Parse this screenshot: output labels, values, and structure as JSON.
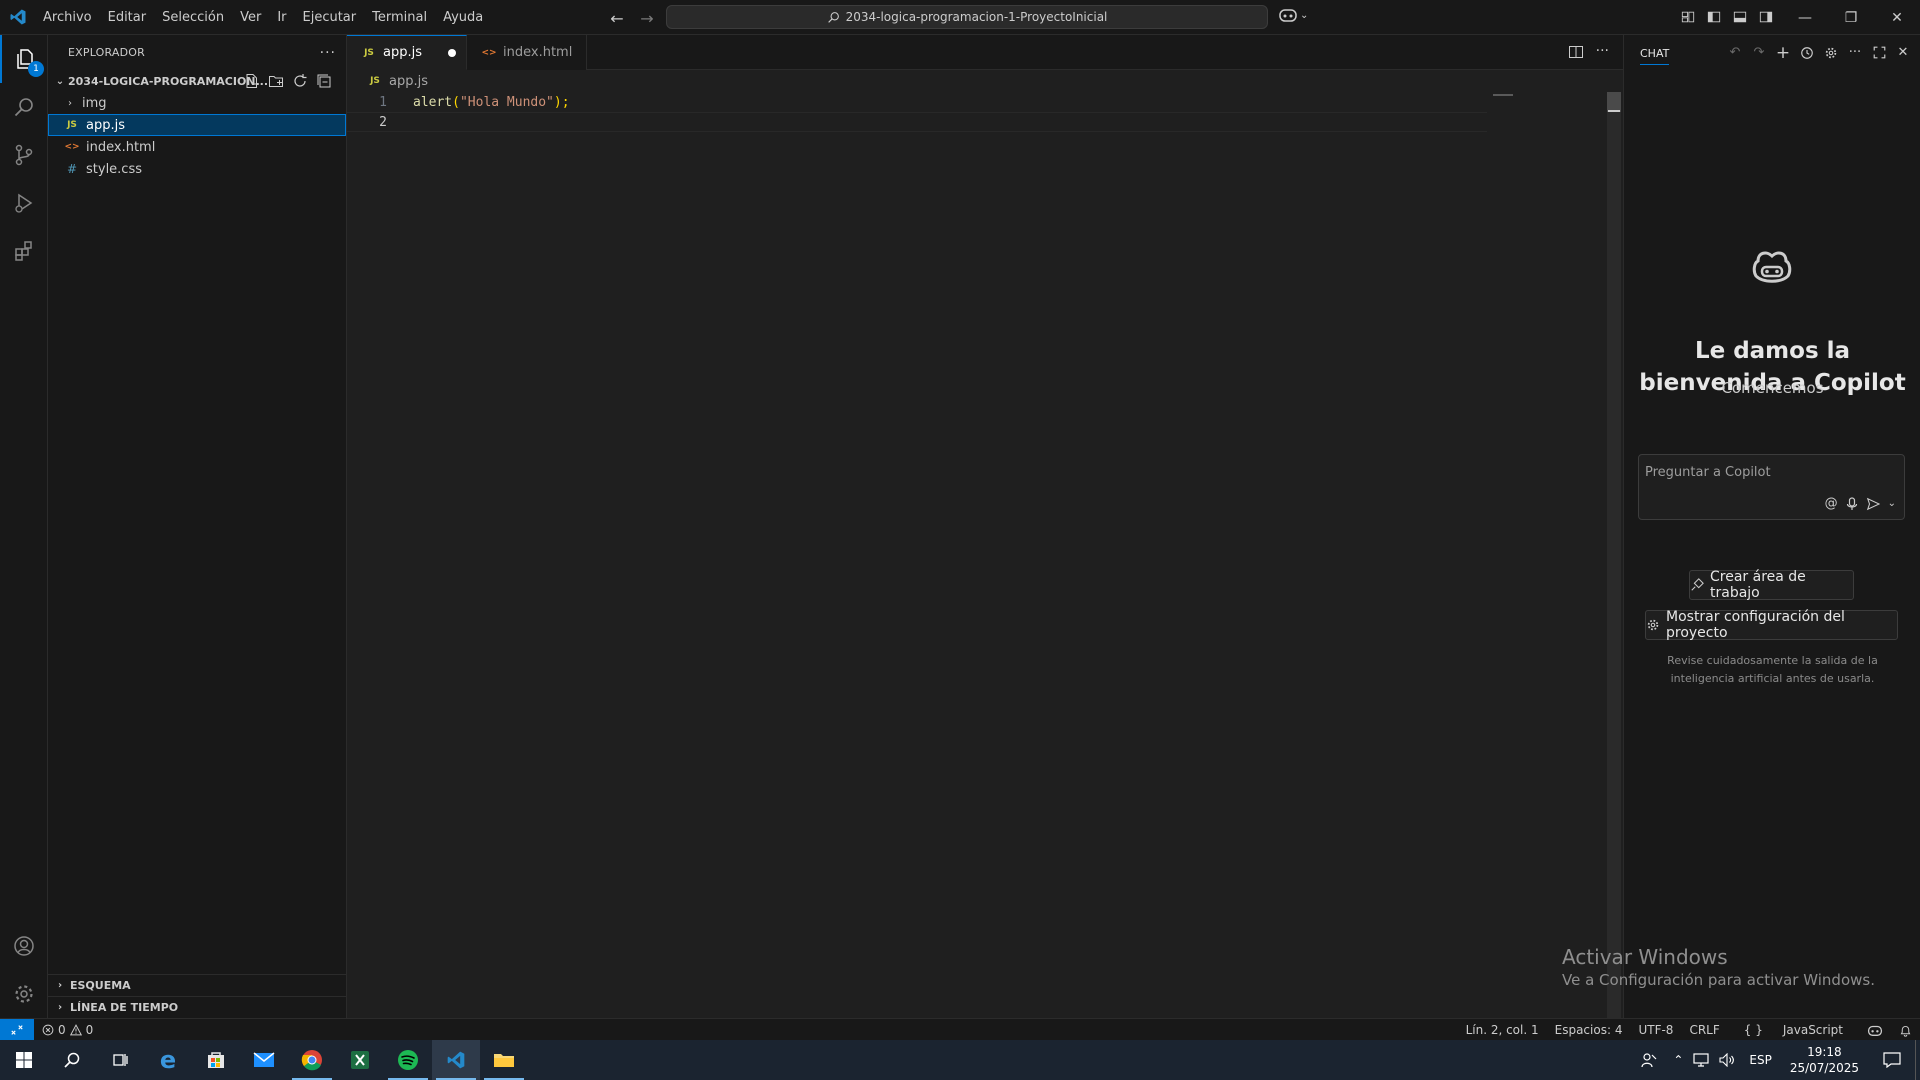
{
  "menu": [
    "Archivo",
    "Editar",
    "Selección",
    "Ver",
    "Ir",
    "Ejecutar",
    "Terminal",
    "Ayuda"
  ],
  "command_center": "2034-logica-programacion-1-ProyectoInicial",
  "activity": {
    "explorer_badge": "1"
  },
  "explorer": {
    "title": "EXPLORADOR",
    "more": "···",
    "root": "2034-LOGICA-PROGRAMACION...",
    "items": [
      {
        "label": "img",
        "type": "folder"
      },
      {
        "label": "app.js",
        "type": "js",
        "icon": "JS"
      },
      {
        "label": "index.html",
        "type": "html",
        "icon": "<>"
      },
      {
        "label": "style.css",
        "type": "css",
        "icon": "#"
      }
    ],
    "outline": "ESQUEMA",
    "timeline": "LÍNEA DE TIEMPO"
  },
  "tabs": [
    {
      "label": "app.js",
      "icon": "JS",
      "active": true,
      "dirty": true
    },
    {
      "label": "index.html",
      "icon": "<>",
      "active": false
    }
  ],
  "breadcrumb": {
    "icon": "JS",
    "file": "app.js"
  },
  "code": {
    "lines": [
      {
        "n": "1",
        "fn": "alert",
        "open": "(",
        "str": "\"Hola Mundo\"",
        "close": ");"
      },
      {
        "n": "2",
        "text": ""
      }
    ]
  },
  "chat": {
    "title": "CHAT",
    "welcome": "Le damos la bienvenida a Copilot",
    "subtitle": "Comencemos",
    "placeholder": "Preguntar a Copilot",
    "create_workspace": "Crear área de trabajo",
    "show_config": "Mostrar configuración del proyecto",
    "disclaimer": "Revise cuidadosamente la salida de la inteligencia artificial antes de usarla."
  },
  "watermark": {
    "line1": "Activar Windows",
    "line2": "Ve a Configuración para activar Windows."
  },
  "status": {
    "errors": "0",
    "warnings": "0",
    "position": "Lín. 2, col. 1",
    "spaces": "Espacios: 4",
    "encoding": "UTF-8",
    "eol": "CRLF",
    "language": "JavaScript"
  },
  "taskbar": {
    "lang": "ESP",
    "time": "19:18",
    "date": "25/07/2025"
  },
  "colors": {
    "accent": "#0078d4",
    "editor_bg": "#1f1f1f",
    "js_icon": "#cbcb41",
    "html_icon": "#e37933",
    "css_icon": "#519aba",
    "string": "#ce9178",
    "function": "#dcdcaa"
  }
}
